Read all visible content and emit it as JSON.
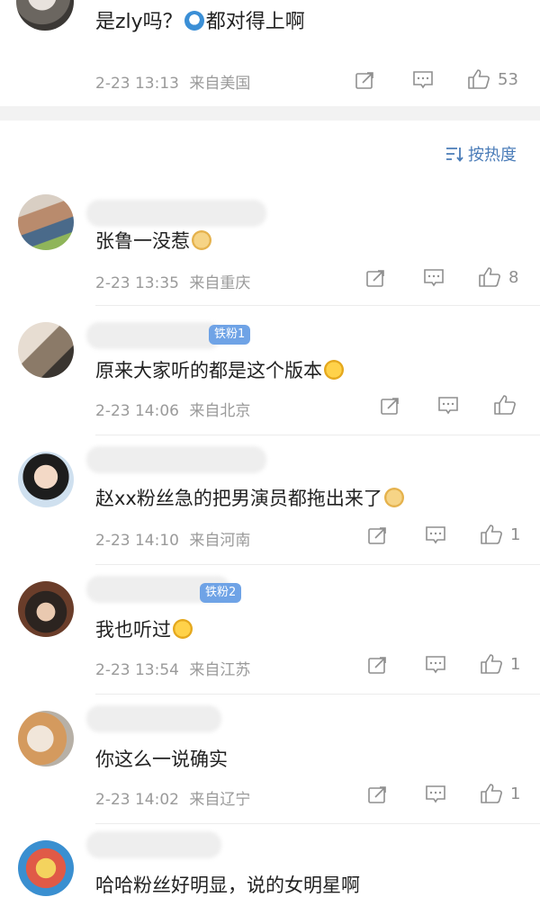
{
  "top_comment": {
    "text_before": "是zly吗？",
    "text_after": "都对得上啊",
    "time": "2-23 13:13",
    "location": "来自美国",
    "like_count": "53"
  },
  "sort": {
    "label": "按热度"
  },
  "comments": [
    {
      "text": "张鲁一没惹",
      "emoji": "doge",
      "time": "2-23 13:35",
      "location": "来自重庆",
      "like_count": "8",
      "badge": ""
    },
    {
      "text": "原来大家听的都是这个版本",
      "emoji": "laugh",
      "time": "2-23 14:06",
      "location": "来自北京",
      "like_count": "",
      "badge": "铁粉1"
    },
    {
      "text": "赵xx粉丝急的把男演员都拖出来了",
      "emoji": "doge",
      "time": "2-23 14:10",
      "location": "来自河南",
      "like_count": "1",
      "badge": ""
    },
    {
      "text": "我也听过",
      "emoji": "laugh",
      "time": "2-23 13:54",
      "location": "来自江苏",
      "like_count": "1",
      "badge": "铁粉2"
    },
    {
      "text": "你这么一说确实",
      "emoji": "",
      "time": "2-23 14:02",
      "location": "来自辽宁",
      "like_count": "1",
      "badge": ""
    },
    {
      "text": "哈哈粉丝好明显，说的女明星啊",
      "emoji": "",
      "time": "",
      "location": "",
      "like_count": "",
      "badge": ""
    }
  ],
  "icons": {
    "share": "share-icon",
    "comment": "comment-icon",
    "like": "thumbs-up-icon",
    "sort": "sort-icon"
  },
  "colors": {
    "link_blue": "#4a7cb8",
    "badge_blue": "#6fa3e6",
    "meta_gray": "#9a9a9a"
  }
}
